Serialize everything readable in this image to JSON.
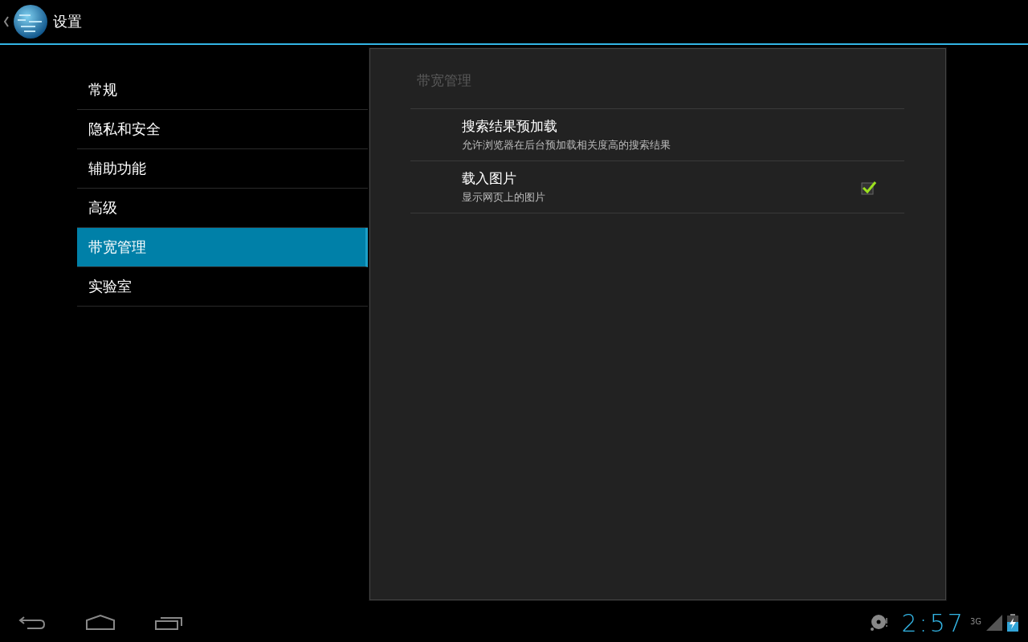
{
  "action_bar": {
    "title": "设置"
  },
  "sidebar": {
    "items": [
      {
        "label": "常规",
        "selected": false
      },
      {
        "label": "隐私和安全",
        "selected": false
      },
      {
        "label": "辅助功能",
        "selected": false
      },
      {
        "label": "高级",
        "selected": false
      },
      {
        "label": "带宽管理",
        "selected": true
      },
      {
        "label": "实验室",
        "selected": false
      }
    ]
  },
  "panel": {
    "header": "带宽管理",
    "preferences": [
      {
        "kind": "plain",
        "title": "搜索结果预加载",
        "summary": "允许浏览器在后台预加载相关度高的搜索结果"
      },
      {
        "kind": "checkbox",
        "title": "载入图片",
        "summary": "显示网页上的图片",
        "checked": true
      }
    ]
  },
  "status_bar": {
    "time": "2:57",
    "network": "3G"
  }
}
